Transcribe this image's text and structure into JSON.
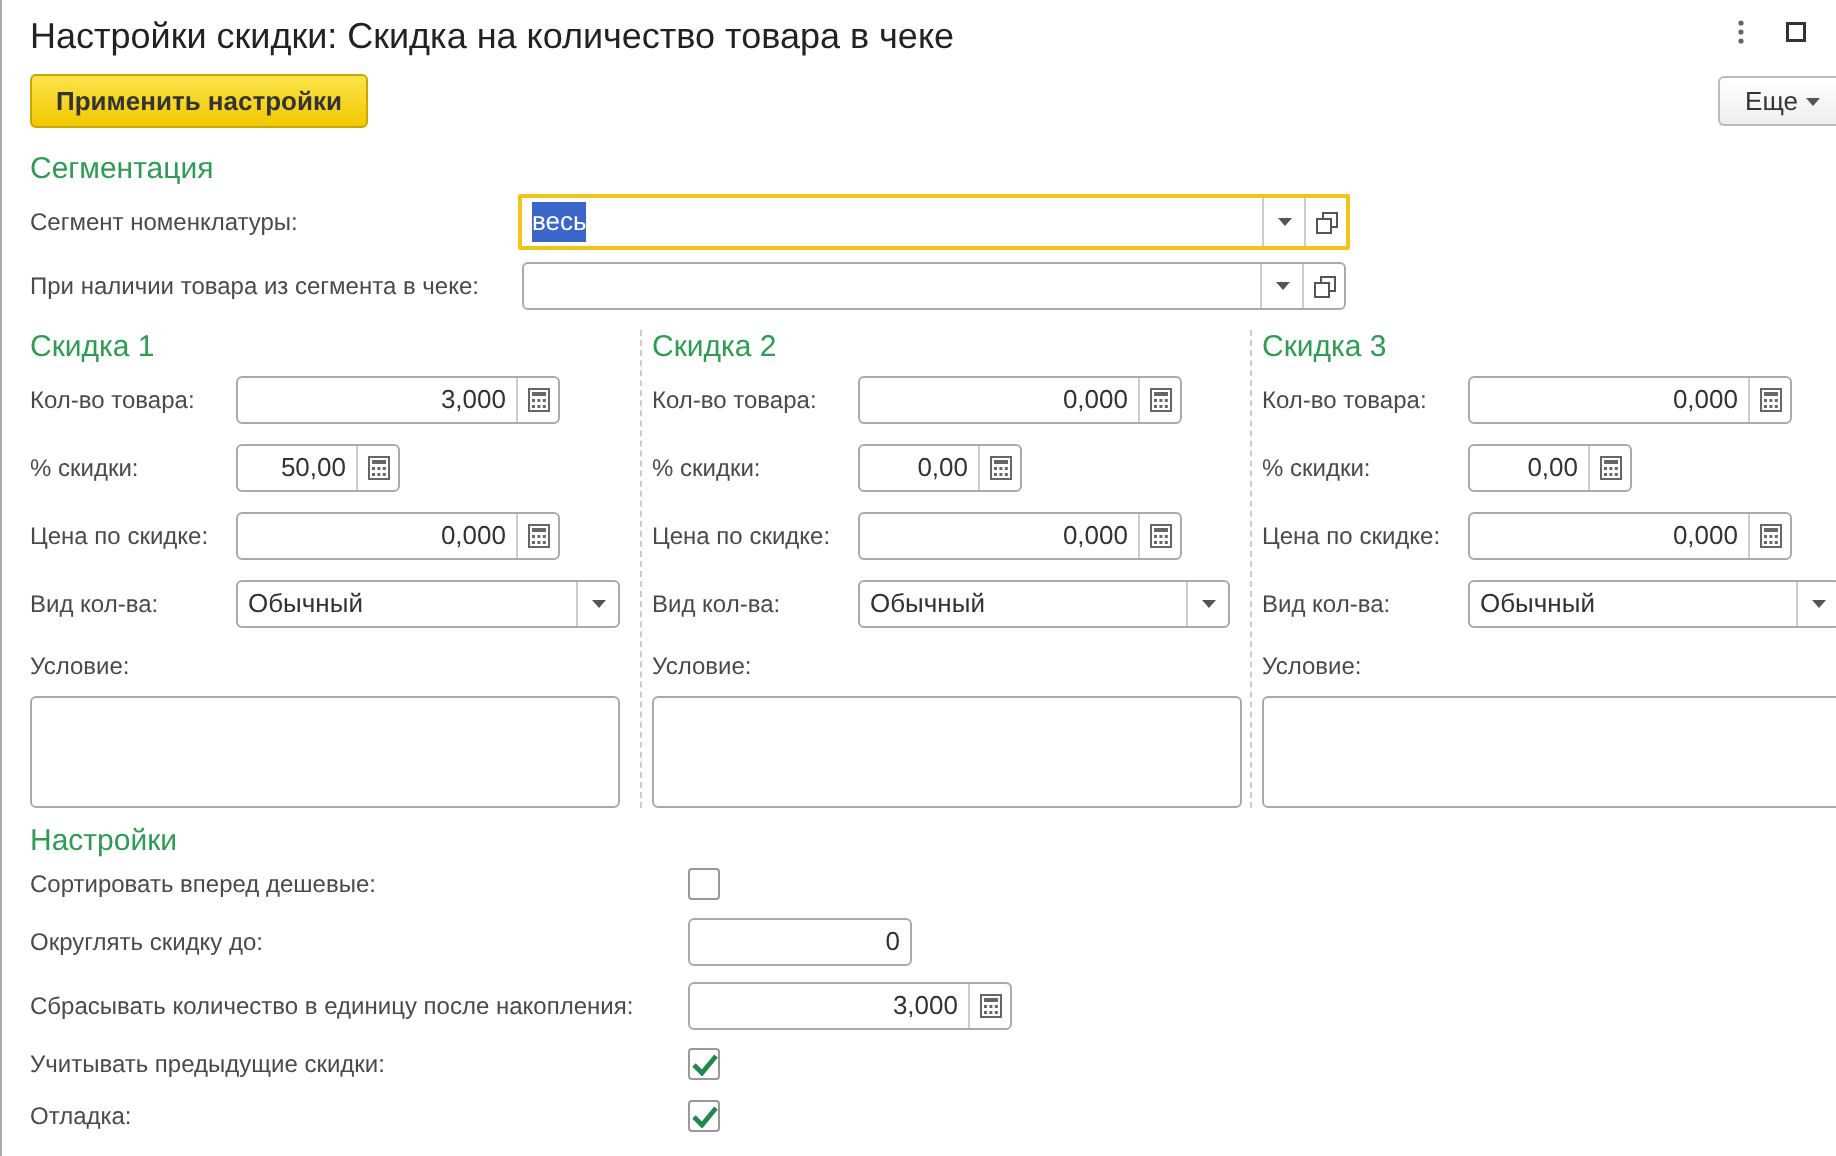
{
  "window": {
    "title": "Настройки скидки: Скидка на количество товара в чеке"
  },
  "toolbar": {
    "primary": "Применить настройки",
    "more": "Еще"
  },
  "segmentation": {
    "heading": "Сегментация",
    "fields": [
      {
        "label": "Сегмент номенклатуры:",
        "value": "весь",
        "focused": true
      },
      {
        "label": "При наличии товара из сегмента в чеке:",
        "focused": false
      }
    ]
  },
  "discounts": [
    {
      "heading": "Скидка 1",
      "fields": [
        {
          "label": "Кол-во товара:",
          "value": "3,000",
          "kind": "calc"
        },
        {
          "label": "% скидки:",
          "value": "50,00",
          "kind": "calc"
        },
        {
          "label": "Цена по скидке:",
          "value": "0,000",
          "kind": "calc"
        },
        {
          "label": "Вид кол-ва:",
          "value": "Обычный",
          "kind": "select"
        }
      ],
      "condition_label": "Условие:"
    },
    {
      "heading": "Скидка 2",
      "fields": [
        {
          "label": "Кол-во товара:",
          "value": "0,000",
          "kind": "calc"
        },
        {
          "label": "% скидки:",
          "value": "0,00",
          "kind": "calc"
        },
        {
          "label": "Цена по скидке:",
          "value": "0,000",
          "kind": "calc"
        },
        {
          "label": "Вид кол-ва:",
          "value": "Обычный",
          "kind": "select"
        }
      ],
      "condition_label": "Условие:"
    },
    {
      "heading": "Скидка 3",
      "fields": [
        {
          "label": "Кол-во товара:",
          "value": "0,000",
          "kind": "calc"
        },
        {
          "label": "% скидки:",
          "value": "0,00",
          "kind": "calc"
        },
        {
          "label": "Цена по скидке:",
          "value": "0,000",
          "kind": "calc"
        },
        {
          "label": "Вид кол-ва:",
          "value": "Обычный",
          "kind": "select"
        }
      ],
      "condition_label": "Условие:"
    }
  ],
  "settings": {
    "heading": "Настройки",
    "rows": [
      {
        "label": "Сортировать вперед дешевые:",
        "kind": "checkbox",
        "checked": false
      },
      {
        "label": "Округлять скидку до:",
        "kind": "number",
        "value": "0"
      },
      {
        "label": "Сбрасывать количество в единицу после накопления:",
        "kind": "calc",
        "value": "3,000"
      },
      {
        "label": "Учитывать предыдущие скидки:",
        "kind": "checkbox",
        "checked": true
      },
      {
        "label": "Отладка:",
        "kind": "checkbox",
        "checked": true
      }
    ]
  }
}
